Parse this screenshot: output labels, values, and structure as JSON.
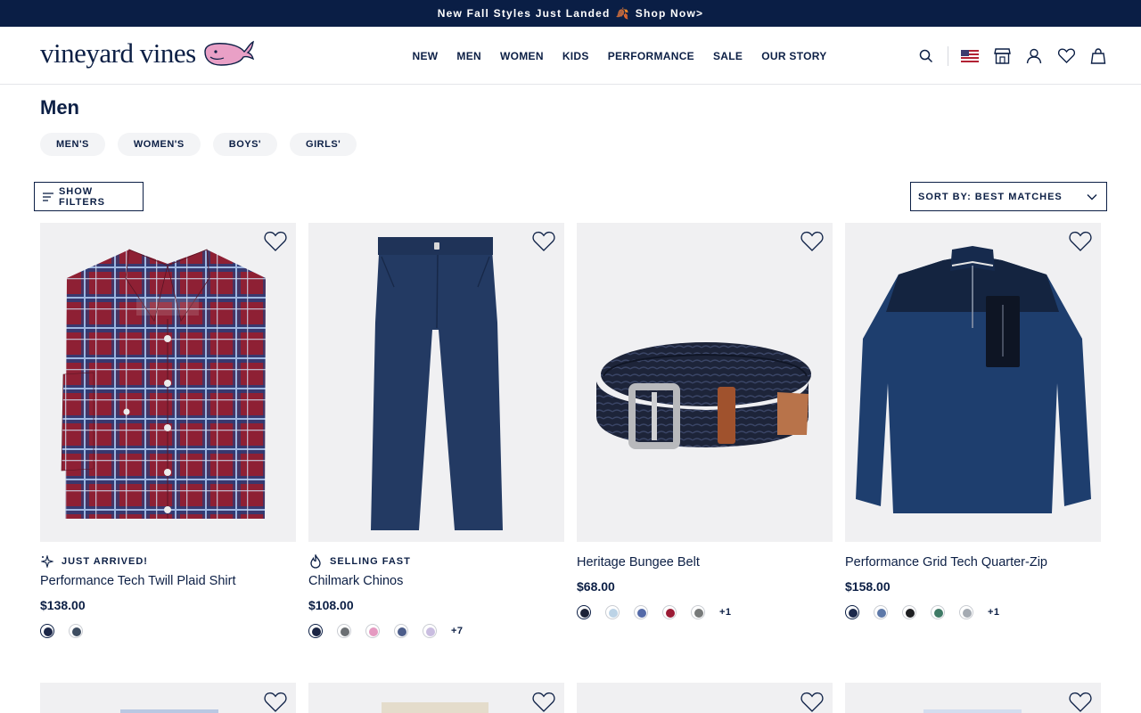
{
  "promo": {
    "text": "New Fall Styles Just Landed",
    "leaf": "🍂",
    "cta": "Shop Now>"
  },
  "header": {
    "logo_text": "vineyard vines",
    "nav": [
      "NEW",
      "MEN",
      "WOMEN",
      "KIDS",
      "PERFORMANCE",
      "SALE",
      "OUR STORY"
    ],
    "icons": [
      "search-icon",
      "us-flag-icon",
      "store-icon",
      "account-icon",
      "wishlist-icon",
      "bag-icon"
    ]
  },
  "page": {
    "title": "Men",
    "chips": [
      "MEN'S",
      "WOMEN'S",
      "BOYS'",
      "GIRLS'"
    ],
    "filters_label": "SHOW FILTERS",
    "sort_label": "SORT BY: BEST MATCHES"
  },
  "colors": {
    "navy": "#0c1f45",
    "promo_bg": "#0a1e45",
    "image_bg": "#f0f0f2",
    "chip_bg": "#f3f4f6"
  },
  "products": [
    {
      "badge": "JUST ARRIVED!",
      "badge_icon": "sparkle-icon",
      "name": "Performance Tech Twill Plaid Shirt",
      "price": "$138.00",
      "swatches": [
        "#1c2748",
        "#3e4d61"
      ],
      "more": ""
    },
    {
      "badge": "SELLING FAST",
      "badge_icon": "flame-icon",
      "name": "Chilmark Chinos",
      "price": "$108.00",
      "swatches": [
        "#1b2544",
        "#6b6f73",
        "#e59ac1",
        "#4c5d8a",
        "#c9bde0"
      ],
      "more": "+7"
    },
    {
      "badge": "",
      "badge_icon": "",
      "name": "Heritage Bungee Belt",
      "price": "$68.00",
      "swatches": [
        "#1d2337",
        "#bcd3e6",
        "#546aa8",
        "#9b1b35",
        "#777a7a"
      ],
      "more": "+1"
    },
    {
      "badge": "",
      "badge_icon": "",
      "name": "Performance Grid Tech Quarter-Zip",
      "price": "$158.00",
      "swatches": [
        "#1d2a4c",
        "#5d78a8",
        "#1e1f22",
        "#3f7a66",
        "#a4aab2"
      ],
      "more": "+1"
    }
  ]
}
